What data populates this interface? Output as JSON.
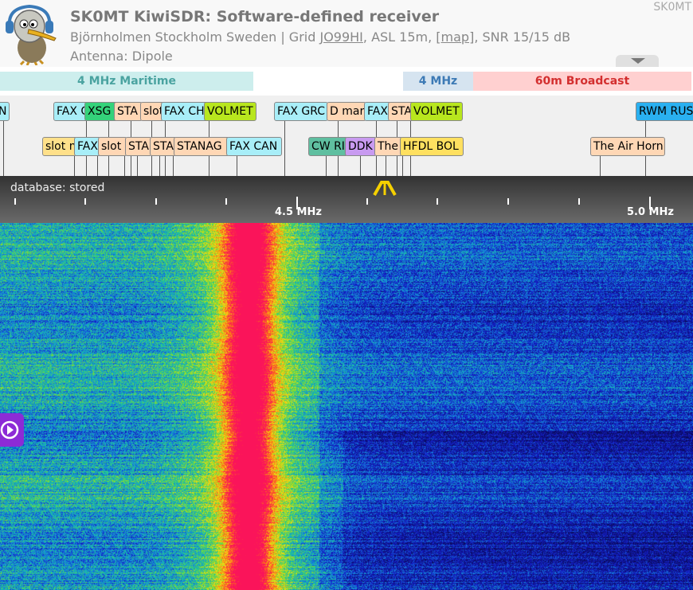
{
  "header": {
    "title": "SK0MT KiwiSDR: Software-defined receiver",
    "location_prefix": "Björnholmen Stockholm Sweden | Grid ",
    "grid": "JO99HI",
    "asl_text": ", ASL 15m, ",
    "map_link": "[map]",
    "snr_text": ", SNR 15/15 dB",
    "antenna": "Antenna: Dipole",
    "callsign_corner": "SK0MT"
  },
  "bands": [
    {
      "label": "4 MHz Maritime",
      "color": "#80cbc4"
    },
    {
      "label": "4 MHz",
      "color": "#1565c0"
    },
    {
      "label": "60m Broadcast",
      "color": "#d32f2f"
    }
  ],
  "stations_row1": [
    {
      "label": "N",
      "bg": "#a8eef8"
    },
    {
      "label": "FAX C",
      "bg": "#a8eef8"
    },
    {
      "label": "XSG",
      "bg": "#34d27a"
    },
    {
      "label": "STA",
      "bg": "#ffd7b5"
    },
    {
      "label": "slot",
      "bg": "#ffd7b5"
    },
    {
      "label": "FAX CH",
      "bg": "#a8eef8"
    },
    {
      "label": "VOLMET",
      "bg": "#b8e61e"
    },
    {
      "label": "FAX GRC",
      "bg": "#a8eef8"
    },
    {
      "label": "D mar",
      "bg": "#ffd7b5"
    },
    {
      "label": "FAX",
      "bg": "#a8eef8"
    },
    {
      "label": "STA",
      "bg": "#ffd7b5"
    },
    {
      "label": "VOLMET",
      "bg": "#b8e61e"
    },
    {
      "label": "RWM RUS",
      "bg": "#2ab0f0"
    }
  ],
  "stations_row2": [
    {
      "label": "slot m",
      "bg": "#ffe08a"
    },
    {
      "label": "FAX",
      "bg": "#a8eef8"
    },
    {
      "label": "slot",
      "bg": "#ffd7b5"
    },
    {
      "label": "STA",
      "bg": "#ffd7b5"
    },
    {
      "label": "STA",
      "bg": "#ffd7b5"
    },
    {
      "label": "STANAG",
      "bg": "#ffd7b5"
    },
    {
      "label": "FAX CAN",
      "bg": "#a8eef8"
    },
    {
      "label": "CW RI",
      "bg": "#5fbfa0"
    },
    {
      "label": "DDK",
      "bg": "#c89af0"
    },
    {
      "label": "The",
      "bg": "#ffd7b5"
    },
    {
      "label": "HFDL BOL",
      "bg": "#ffe060"
    },
    {
      "label": "The Air Horn",
      "bg": "#ffd7b5"
    }
  ],
  "scale": {
    "database_status": "database: stored",
    "major_labels": [
      "4.5 MHz",
      "5.0 MHz"
    ]
  }
}
